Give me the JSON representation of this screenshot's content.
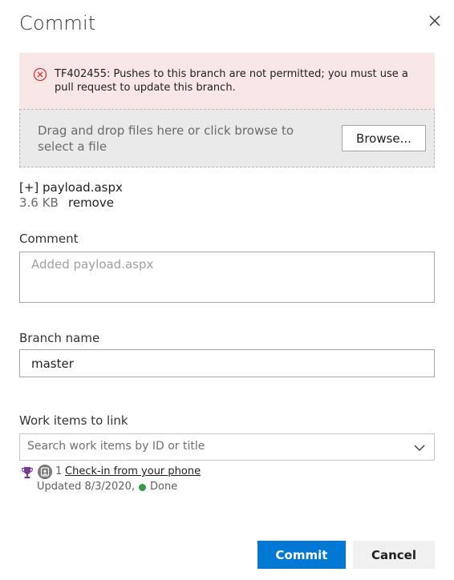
{
  "dialog": {
    "title": "Commit"
  },
  "error": {
    "message": "TF402455: Pushes to this branch are not permitted; you must use a pull request to update this branch.",
    "icon": "error-circle-icon",
    "color": "#d13438"
  },
  "upload": {
    "drop_text": "Drag and drop files here or click browse to select a file",
    "browse_label": "Browse..."
  },
  "file": {
    "name": "[+] payload.aspx",
    "size": "3.6 KB",
    "remove_label": "remove"
  },
  "comment": {
    "label": "Comment",
    "placeholder": "Added payload.aspx",
    "value": ""
  },
  "branch": {
    "label": "Branch name",
    "value": "master"
  },
  "work_items": {
    "label": "Work items to link",
    "search_placeholder": "Search work items by ID or title",
    "items": [
      {
        "type_icon": "trophy-icon",
        "id": "1",
        "title": "Check-in from your phone",
        "updated": "Updated 8/3/2020,",
        "state": "Done",
        "state_color": "#339947"
      }
    ]
  },
  "actions": {
    "commit_label": "Commit",
    "cancel_label": "Cancel",
    "primary_color": "#0078d4"
  }
}
